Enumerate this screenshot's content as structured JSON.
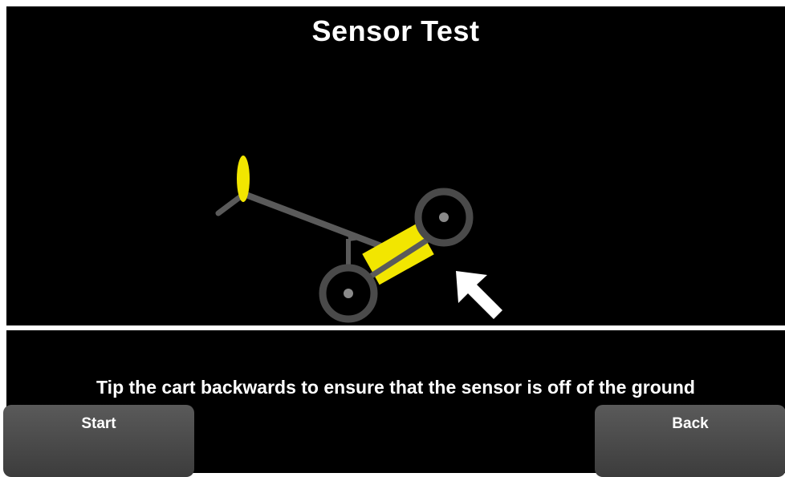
{
  "screen": {
    "title": "Sensor Test",
    "instruction": "Tip the cart backwards to ensure that the sensor is off of the ground"
  },
  "buttons": {
    "start_label": "Start",
    "back_label": "Back"
  },
  "icons": {
    "illustration": "cart-tipped-backward-icon",
    "arrow": "arrow-up-left-icon"
  },
  "colors": {
    "background": "#000000",
    "text": "#ffffff",
    "sensor": "#f2e600",
    "cart_frame": "#5a5a5a",
    "button": "#4a4a4a"
  }
}
